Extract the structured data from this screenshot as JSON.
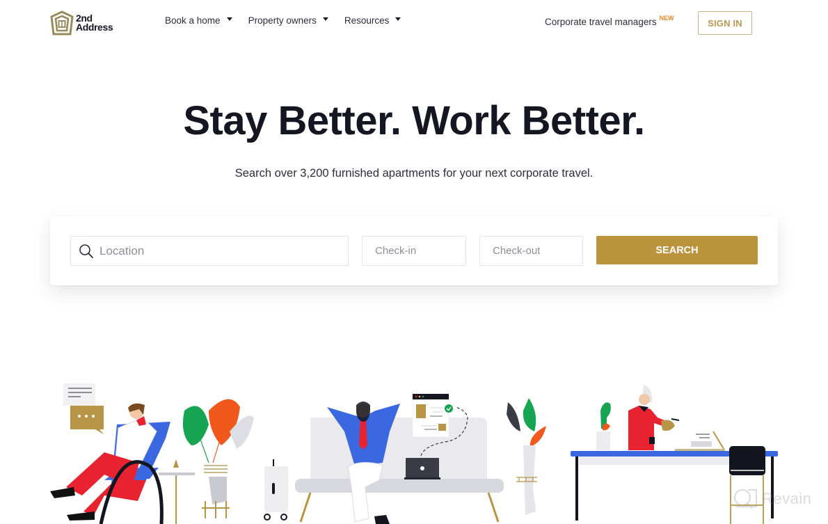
{
  "header": {
    "logo": {
      "line1": "2nd",
      "line2": "Address",
      "icon": "house-logo-icon"
    },
    "nav": [
      {
        "label": "Book a home",
        "icon": "caret-down-icon"
      },
      {
        "label": "Property owners",
        "icon": "caret-down-icon"
      },
      {
        "label": "Resources",
        "icon": "caret-down-icon"
      }
    ],
    "corporate_link": {
      "label": "Corporate travel managers",
      "badge": "NEW"
    },
    "signin_label": "SIGN IN"
  },
  "hero": {
    "title": "Stay Better. Work Better.",
    "subtitle": "Search over 3,200 furnished apartments for your next corporate travel."
  },
  "search": {
    "location_placeholder": "Location",
    "location_value": "",
    "checkin_placeholder": "Check-in",
    "checkout_placeholder": "Check-out",
    "button_label": "SEARCH",
    "icon": "search-icon"
  },
  "illustration": {
    "scenes": [
      "man-in-lounge-chair",
      "man-relaxing-on-sofa-with-laptop",
      "woman-at-desk-pouring-drink"
    ]
  },
  "watermark": {
    "label": "Revain"
  },
  "colors": {
    "brand_gold": "#bb933d",
    "logo_olive": "#8c8158",
    "heading": "#141622",
    "new_badge": "#e8852b",
    "illustration_blue": "#3b67e0",
    "illustration_red": "#e8232f",
    "illustration_green": "#18a553",
    "illustration_orange": "#f0581c"
  }
}
